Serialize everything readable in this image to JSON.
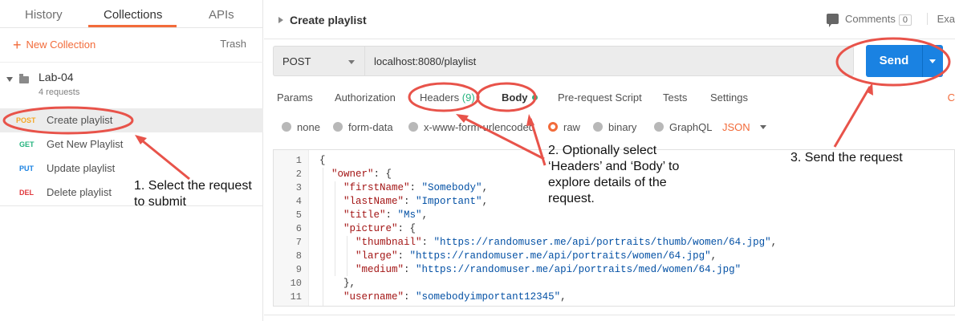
{
  "sidebar": {
    "tabs": [
      "History",
      "Collections",
      "APIs"
    ],
    "new_collection": "New Collection",
    "trash": "Trash",
    "collection": {
      "name": "Lab-04",
      "count": "4 requests"
    },
    "requests": [
      {
        "method": "POST",
        "name": "Create playlist",
        "color": "#f5a623"
      },
      {
        "method": "GET",
        "name": "Get New Playlist",
        "color": "#26b47f"
      },
      {
        "method": "PUT",
        "name": "Update playlist",
        "color": "#1a82e2"
      },
      {
        "method": "DEL",
        "name": "Delete playlist",
        "color": "#e0393e"
      }
    ]
  },
  "main": {
    "breadcrumb": "Create playlist",
    "comments_label": "Comments",
    "comments_count": "0",
    "examples_label": "Exa",
    "method": "POST",
    "url": "localhost:8080/playlist",
    "send_label": "Send",
    "tabs": [
      "Params",
      "Authorization",
      "Headers",
      "Body",
      "Pre-request Script",
      "Tests",
      "Settings"
    ],
    "headers_count": "(9)",
    "cookies_label": "C",
    "body_types": [
      "none",
      "form-data",
      "x-www-form-urlencoded",
      "raw",
      "binary",
      "GraphQL"
    ],
    "body_format": "JSON",
    "line_numbers": [
      "1",
      "2",
      "3",
      "4",
      "5",
      "6",
      "7",
      "8",
      "9",
      "10",
      "11"
    ]
  },
  "annotations": {
    "step1": "1. Select the request\nto submit",
    "step2": "2. Optionally select\n‘Headers’ and ‘Body’ to\nexplore details of the\nrequest.",
    "step3": "3. Send the request"
  },
  "colors": {
    "accent": "#f26b3a",
    "send": "#1a82e2",
    "annotation": "#e8534a"
  }
}
